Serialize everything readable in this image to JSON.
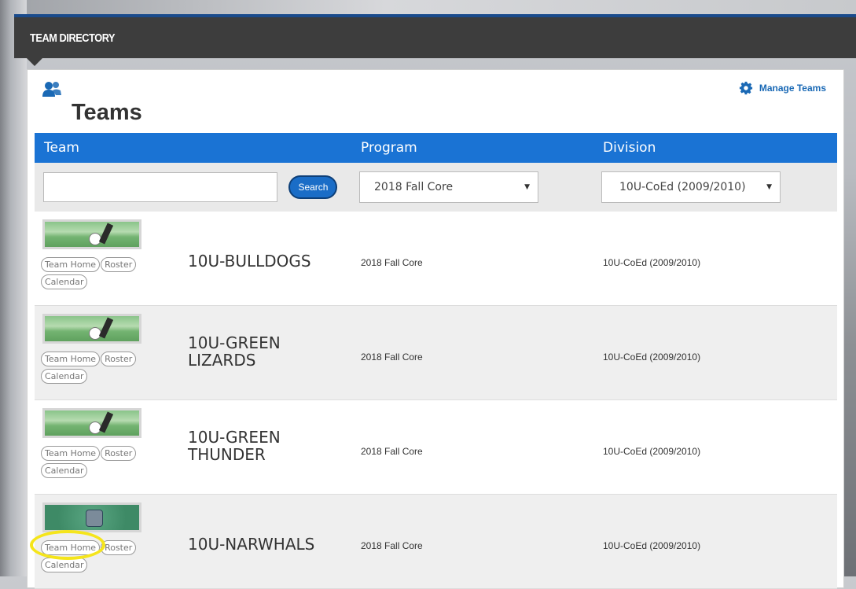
{
  "header": {
    "title": "TEAM DIRECTORY"
  },
  "panel": {
    "title": "Teams",
    "manage_label": "Manage Teams"
  },
  "columns": {
    "team": "Team",
    "program": "Program",
    "division": "Division"
  },
  "filters": {
    "search_value": "",
    "search_label": "Search",
    "program_selected": "2018 Fall Core",
    "division_selected": "10U-CoEd (2009/2010)"
  },
  "teams": [
    {
      "name_line1": "10U-BULLDOGS",
      "name_line2": "",
      "program": "2018 Fall Core",
      "division": "10U-CoEd (2009/2010)",
      "links": [
        "Team Home",
        "Roster",
        "Calendar"
      ]
    },
    {
      "name_line1": "10U-GREEN",
      "name_line2": "LIZARDS",
      "program": "2018 Fall Core",
      "division": "10U-CoEd (2009/2010)",
      "links": [
        "Team Home",
        "Roster",
        "Calendar"
      ]
    },
    {
      "name_line1": "10U-GREEN",
      "name_line2": "THUNDER",
      "program": "2018 Fall Core",
      "division": "10U-CoEd (2009/2010)",
      "links": [
        "Team Home",
        "Roster",
        "Calendar"
      ]
    },
    {
      "name_line1": "10U-NARWHALS",
      "name_line2": "",
      "program": "2018 Fall Core",
      "division": "10U-CoEd (2009/2010)",
      "links": [
        "Team Home",
        "Roster",
        "Calendar"
      ]
    }
  ],
  "colors": {
    "header_bg": "#3d3d3d",
    "table_header": "#1a73d4",
    "link": "#1a69b5",
    "highlight": "#f5e51b"
  }
}
